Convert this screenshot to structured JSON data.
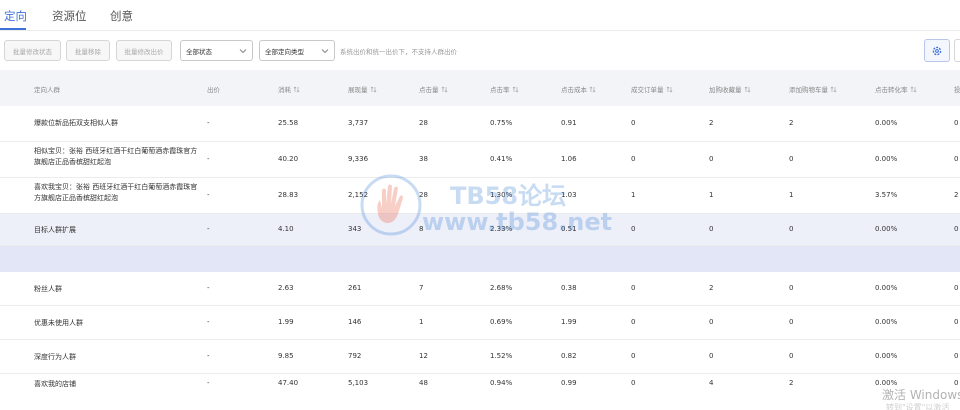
{
  "tabs": [
    {
      "label": "定向",
      "active": true
    },
    {
      "label": "资源位",
      "active": false
    },
    {
      "label": "创意",
      "active": false
    }
  ],
  "toolbar": {
    "batch_status_label": "批量修改状态",
    "batch_remove_label": "批量移除",
    "batch_bid_label": "批量修改出价",
    "status_select_value": "全部状态",
    "type_select_value": "全部定向类型",
    "hint": "系统出价和统一出价下，不支持人群出价",
    "settings_icon": "gear-icon"
  },
  "table": {
    "columns": [
      "定向人群",
      "出价",
      "消耗",
      "展现量",
      "点击量",
      "点击率",
      "点击成本",
      "成交订单量",
      "加购收藏量",
      "添加购物车量",
      "点击转化率",
      "投"
    ],
    "sortable": [
      false,
      false,
      true,
      true,
      true,
      true,
      true,
      true,
      true,
      true,
      true,
      false
    ],
    "rows": [
      {
        "name": "爆款位新品拓双支相似人群",
        "bid": "-",
        "cost": "25.58",
        "impressions": "3,737",
        "clicks": "28",
        "ctr": "0.75%",
        "cpc": "0.91",
        "orders": "0",
        "fav": "2",
        "cart": "2",
        "cvr": "0.00%",
        "extra": "0"
      },
      {
        "name": "相似宝贝：张裕 西班牙红酒干红白葡萄酒赤霞珠官方旗舰店正品香槟甜红起泡",
        "bid": "-",
        "cost": "40.20",
        "impressions": "9,336",
        "clicks": "38",
        "ctr": "0.41%",
        "cpc": "1.06",
        "orders": "0",
        "fav": "0",
        "cart": "0",
        "cvr": "0.00%",
        "extra": "0"
      },
      {
        "name": "喜欢我宝贝：张裕 西班牙红酒干红白葡萄酒赤霞珠官方旗舰店正品香槟甜红起泡",
        "bid": "-",
        "cost": "28.83",
        "impressions": "2,152",
        "clicks": "28",
        "ctr": "1.30%",
        "cpc": "1.03",
        "orders": "1",
        "fav": "1",
        "cart": "1",
        "cvr": "3.57%",
        "extra": "2"
      },
      {
        "name": "目标人群扩展",
        "bid": "-",
        "cost": "4.10",
        "impressions": "343",
        "clicks": "8",
        "ctr": "2.33%",
        "cpc": "0.51",
        "orders": "0",
        "fav": "0",
        "cart": "0",
        "cvr": "0.00%",
        "extra": "0"
      },
      {
        "name": "粉丝人群",
        "bid": "-",
        "cost": "2.63",
        "impressions": "261",
        "clicks": "7",
        "ctr": "2.68%",
        "cpc": "0.38",
        "orders": "0",
        "fav": "2",
        "cart": "0",
        "cvr": "0.00%",
        "extra": "0"
      },
      {
        "name": "优惠未使用人群",
        "bid": "-",
        "cost": "1.99",
        "impressions": "146",
        "clicks": "1",
        "ctr": "0.69%",
        "cpc": "1.99",
        "orders": "0",
        "fav": "0",
        "cart": "0",
        "cvr": "0.00%",
        "extra": "0"
      },
      {
        "name": "深度行为人群",
        "bid": "-",
        "cost": "9.85",
        "impressions": "792",
        "clicks": "12",
        "ctr": "1.52%",
        "cpc": "0.82",
        "orders": "0",
        "fav": "0",
        "cart": "0",
        "cvr": "0.00%",
        "extra": "0"
      },
      {
        "name": "喜欢我的店铺",
        "bid": "-",
        "cost": "47.40",
        "impressions": "5,103",
        "clicks": "48",
        "ctr": "0.94%",
        "cpc": "0.99",
        "orders": "0",
        "fav": "4",
        "cart": "2",
        "cvr": "0.00%",
        "extra": "0"
      }
    ]
  },
  "watermark": {
    "line1": "TB58论坛",
    "line2": "www.tb58.net"
  },
  "os_overlay": {
    "activate": "激活 Windows",
    "sub": "转到\"设置\"以激活"
  },
  "colors": {
    "accent": "#3f72d9",
    "header_bg": "#f3f4f7",
    "highlight_row": "#eef0f9",
    "band_row": "#e2e6f6"
  }
}
